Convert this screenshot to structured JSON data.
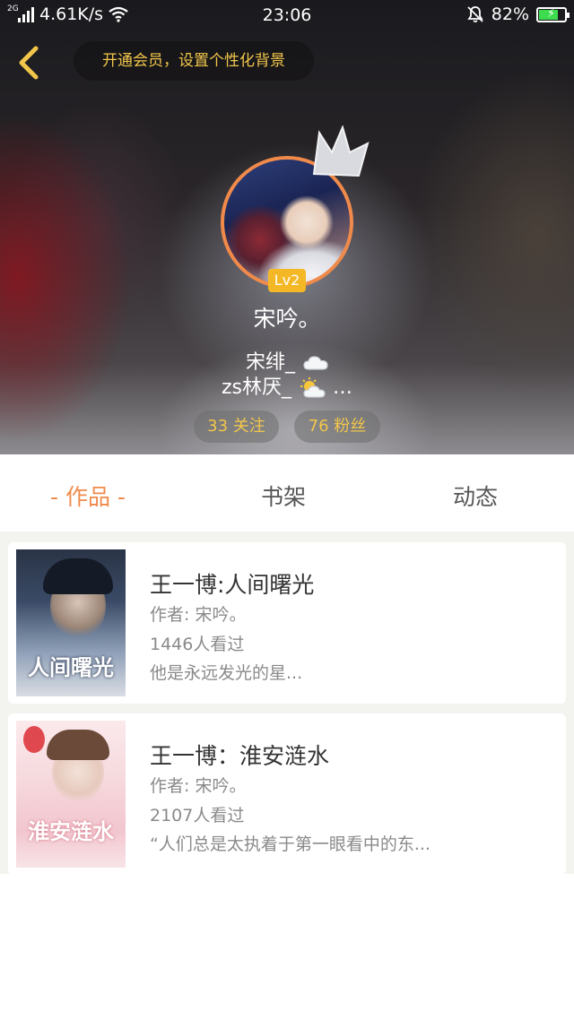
{
  "status_bar": {
    "network_type": "2G",
    "speed": "4.61K/s",
    "time": "23:06",
    "battery": "82%",
    "battery_level": 0.82,
    "icons": [
      "signal-icon",
      "wifi-icon",
      "mute-bell-icon",
      "battery-icon"
    ]
  },
  "header": {
    "vip_prompt": "开通会员，设置个性化背景",
    "level": "Lv2",
    "nickname": "宋吟。",
    "signature_line1": "宋绯_",
    "signature_line2": "zs林厌_",
    "signature_suffix": "…",
    "follow_count": "33 关注",
    "fans_count": "76 粉丝"
  },
  "tabs": [
    {
      "label": "- 作品 -",
      "active": true
    },
    {
      "label": "书架",
      "active": false
    },
    {
      "label": "动态",
      "active": false
    }
  ],
  "works": [
    {
      "title": "王一博:人间曙光",
      "author": "作者: 宋吟。",
      "views": "1446人看过",
      "excerpt": "他是永远发光的星...",
      "cover_text": "人间曙光"
    },
    {
      "title": "王一博：淮安涟水",
      "author": "作者: 宋吟。",
      "views": "2107人看过",
      "excerpt": "“人们总是太执着于第一眼看中的东...",
      "cover_text": "淮安涟水"
    }
  ],
  "colors": {
    "accent": "#f08a4b",
    "gold": "#f2c64b",
    "badge": "#f4b826"
  }
}
